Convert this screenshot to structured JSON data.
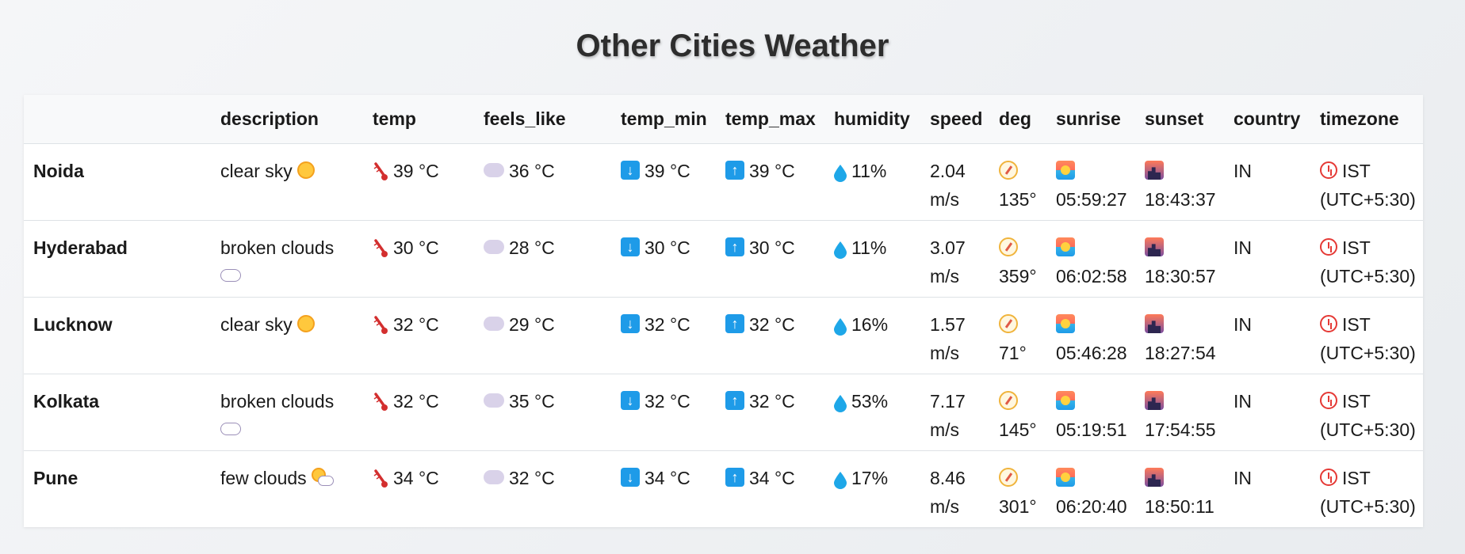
{
  "title": "Other Cities Weather",
  "headers": [
    "",
    "description",
    "temp",
    "feels_like",
    "temp_min",
    "temp_max",
    "humidity",
    "speed",
    "deg",
    "sunrise",
    "sunset",
    "country",
    "timezone"
  ],
  "rows": [
    {
      "city": "Noida",
      "description": "clear sky",
      "icon": "sun-icon",
      "temp": "39 °C",
      "feels_like": "36 °C",
      "temp_min": "39 °C",
      "temp_max": "39 °C",
      "humidity": "11%",
      "speed": "2.04 m/s",
      "deg": "135°",
      "sunrise": "05:59:27",
      "sunset": "18:43:37",
      "country": "IN",
      "timezone": "IST (UTC+5:30)"
    },
    {
      "city": "Hyderabad",
      "description": "broken clouds",
      "icon": "cloud-icon",
      "temp": "30 °C",
      "feels_like": "28 °C",
      "temp_min": "30 °C",
      "temp_max": "30 °C",
      "humidity": "11%",
      "speed": "3.07 m/s",
      "deg": "359°",
      "sunrise": "06:02:58",
      "sunset": "18:30:57",
      "country": "IN",
      "timezone": "IST (UTC+5:30)"
    },
    {
      "city": "Lucknow",
      "description": "clear sky",
      "icon": "sun-icon",
      "temp": "32 °C",
      "feels_like": "29 °C",
      "temp_min": "32 °C",
      "temp_max": "32 °C",
      "humidity": "16%",
      "speed": "1.57 m/s",
      "deg": "71°",
      "sunrise": "05:46:28",
      "sunset": "18:27:54",
      "country": "IN",
      "timezone": "IST (UTC+5:30)"
    },
    {
      "city": "Kolkata",
      "description": "broken clouds",
      "icon": "cloud-icon",
      "temp": "32 °C",
      "feels_like": "35 °C",
      "temp_min": "32 °C",
      "temp_max": "32 °C",
      "humidity": "53%",
      "speed": "7.17 m/s",
      "deg": "145°",
      "sunrise": "05:19:51",
      "sunset": "17:54:55",
      "country": "IN",
      "timezone": "IST (UTC+5:30)"
    },
    {
      "city": "Pune",
      "description": "few clouds",
      "icon": "few-clouds-icon",
      "temp": "34 °C",
      "feels_like": "32 °C",
      "temp_min": "34 °C",
      "temp_max": "34 °C",
      "humidity": "17%",
      "speed": "8.46 m/s",
      "deg": "301°",
      "sunrise": "06:20:40",
      "sunset": "18:50:11",
      "country": "IN",
      "timezone": "IST (UTC+5:30)"
    }
  ],
  "colors": {
    "arrow": "#1e9be8",
    "thermometer": "#d32f2f",
    "humidity": "#1ea7e8",
    "alarm": "#e53935"
  }
}
